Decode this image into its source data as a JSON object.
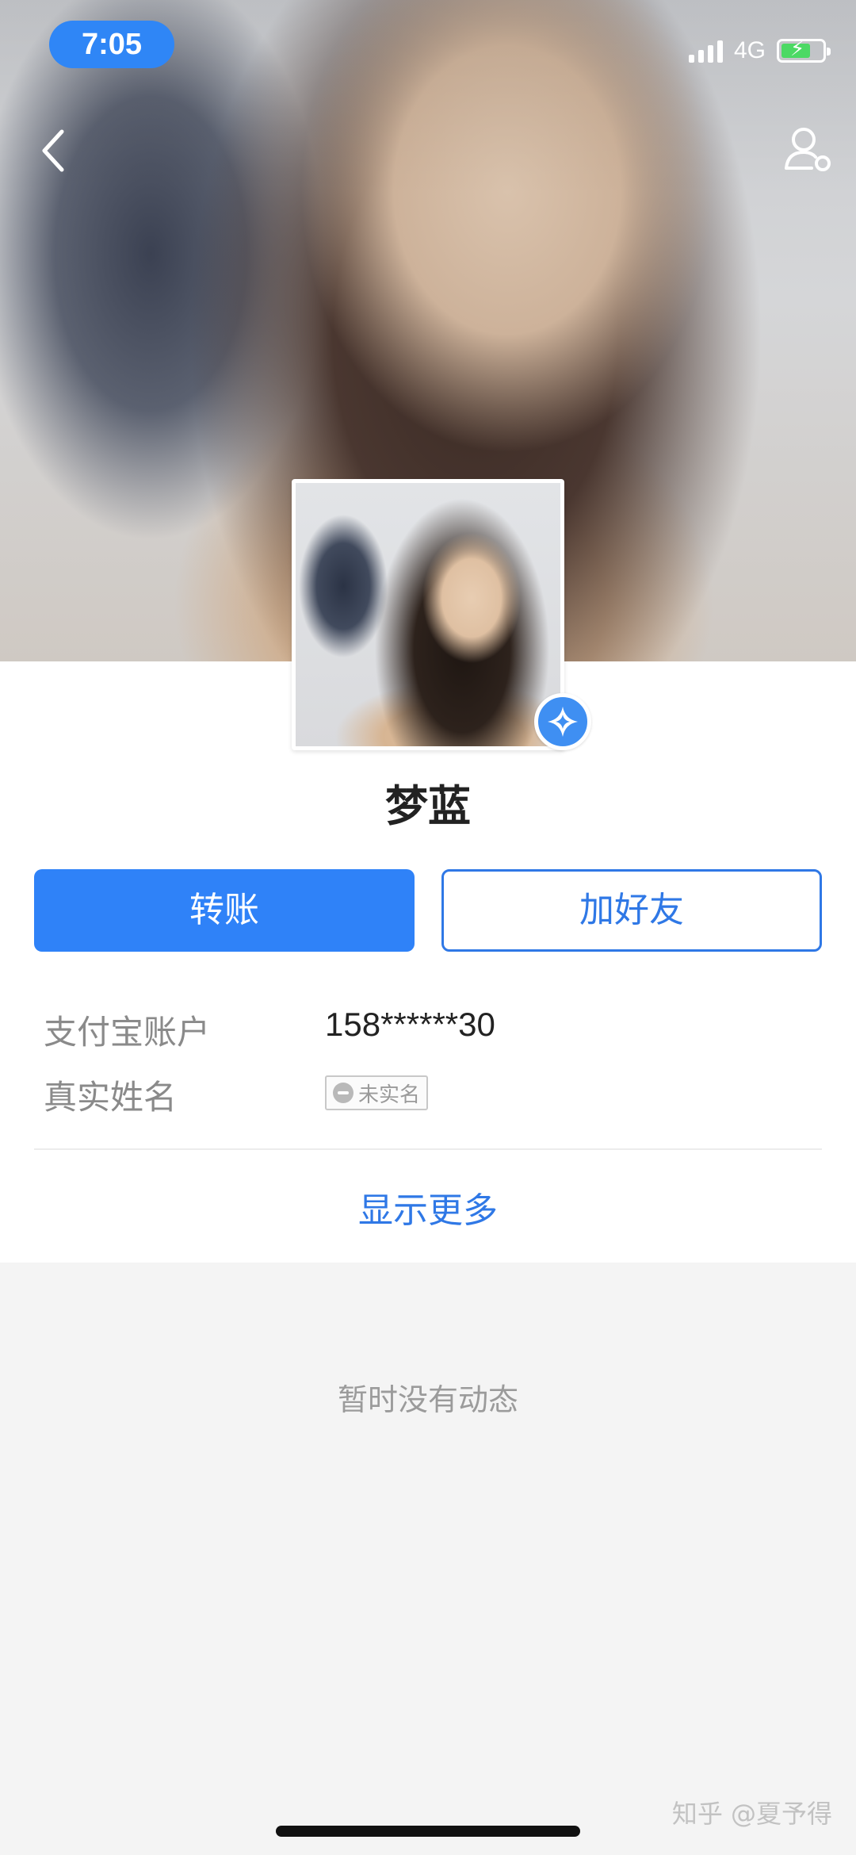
{
  "status_bar": {
    "time": "7:05",
    "network": "4G",
    "battery_charging": true,
    "accent_color": "#2f86f6"
  },
  "nav": {
    "back_icon": "chevron-left-icon",
    "profile_icon": "user-settings-icon"
  },
  "profile": {
    "name": "梦蓝",
    "verified_badge_icon": "star-badge-icon"
  },
  "actions": {
    "transfer_label": "转账",
    "add_friend_label": "加好友"
  },
  "info": {
    "account_label": "支付宝账户",
    "account_value": "158******30",
    "real_name_label": "真实姓名",
    "real_name_status": "未实名"
  },
  "show_more_label": "显示更多",
  "feed": {
    "empty_text": "暂时没有动态"
  },
  "watermark": "知乎 @夏予得",
  "colors": {
    "primary": "#2f82f8",
    "link": "#2f78e6",
    "muted_text": "#8a8a8a",
    "background": "#f4f4f4"
  }
}
